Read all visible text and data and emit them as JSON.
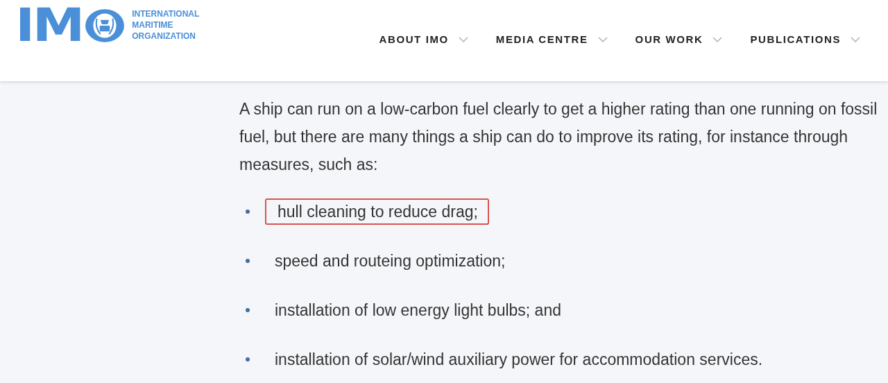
{
  "logo": {
    "letters": "IM",
    "name_lines": [
      "INTERNATIONAL",
      "MARITIME",
      "ORGANIZATION"
    ]
  },
  "nav": [
    {
      "label": "ABOUT IMO"
    },
    {
      "label": "MEDIA CENTRE"
    },
    {
      "label": "OUR WORK"
    },
    {
      "label": "PUBLICATIONS"
    }
  ],
  "intro": " A ship can run on a low-carbon fuel clearly to get a higher rating than one running on fossil fuel, but there are many things a ship can do to improve its rating, for instance through measures, such as:",
  "measures": [
    {
      "text": "hull cleaning to reduce drag;",
      "highlighted": true
    },
    {
      "text": "speed and routeing optimization;",
      "highlighted": false
    },
    {
      "text": "installation of low energy light bulbs; and",
      "highlighted": false
    },
    {
      "text": "installation of solar/wind auxiliary power for accommodation services.",
      "highlighted": false
    }
  ]
}
